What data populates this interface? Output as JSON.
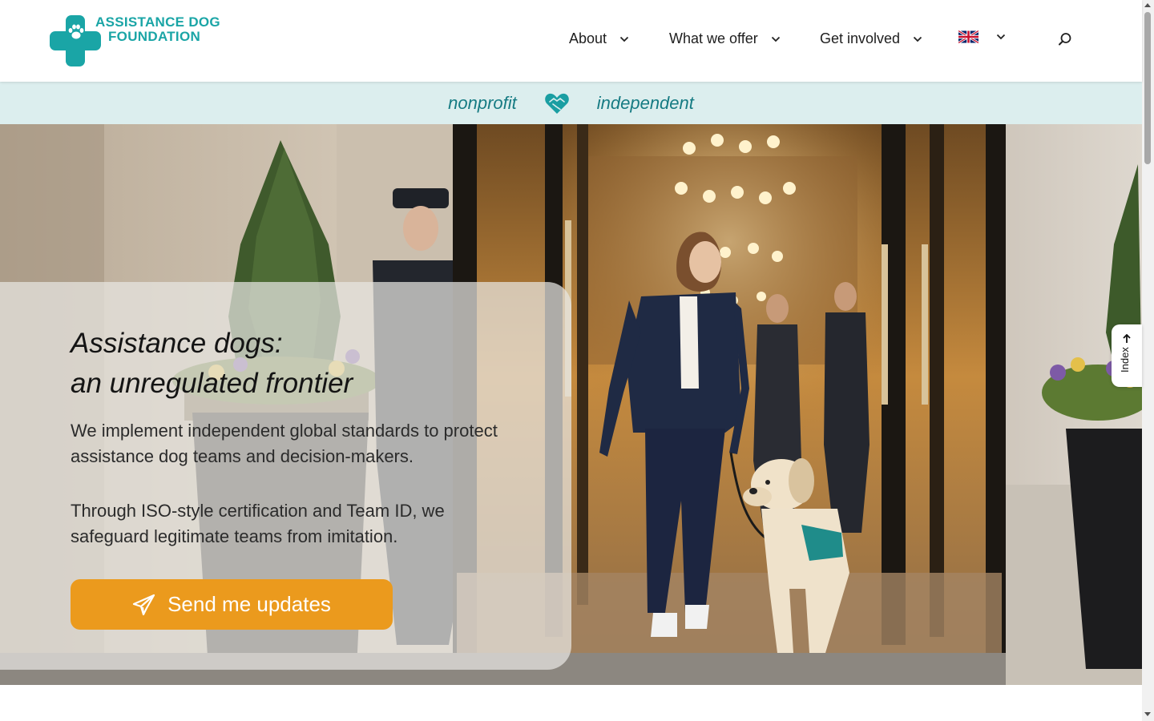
{
  "brand": {
    "line1": "ASSISTANCE DOG",
    "line2": "FOUNDATION",
    "color": "#1aa5a6"
  },
  "nav": {
    "about": "About",
    "what_we_offer": "What we offer",
    "get_involved": "Get involved",
    "language_icon": "uk-flag-icon",
    "search_icon": "search-icon"
  },
  "tagline": {
    "left": "nonprofit",
    "right": "independent",
    "icon": "heart-handshake-icon",
    "band_color": "#dceeee",
    "text_color": "#167b83"
  },
  "hero": {
    "title_line1": "Assistance dogs:",
    "title_line2": "an unregulated frontier",
    "paragraph1": "We implement independent global standards to protect assistance dog teams and decision-makers.",
    "paragraph2": "Through ISO-style certification and Team ID, we safeguard legitimate teams from imitation.",
    "cta_label": "Send me updates",
    "cta_icon": "paper-plane-icon",
    "cta_color": "#eb9a1d"
  },
  "index_tab": {
    "label": "Index",
    "icon": "arrow-up-icon"
  }
}
